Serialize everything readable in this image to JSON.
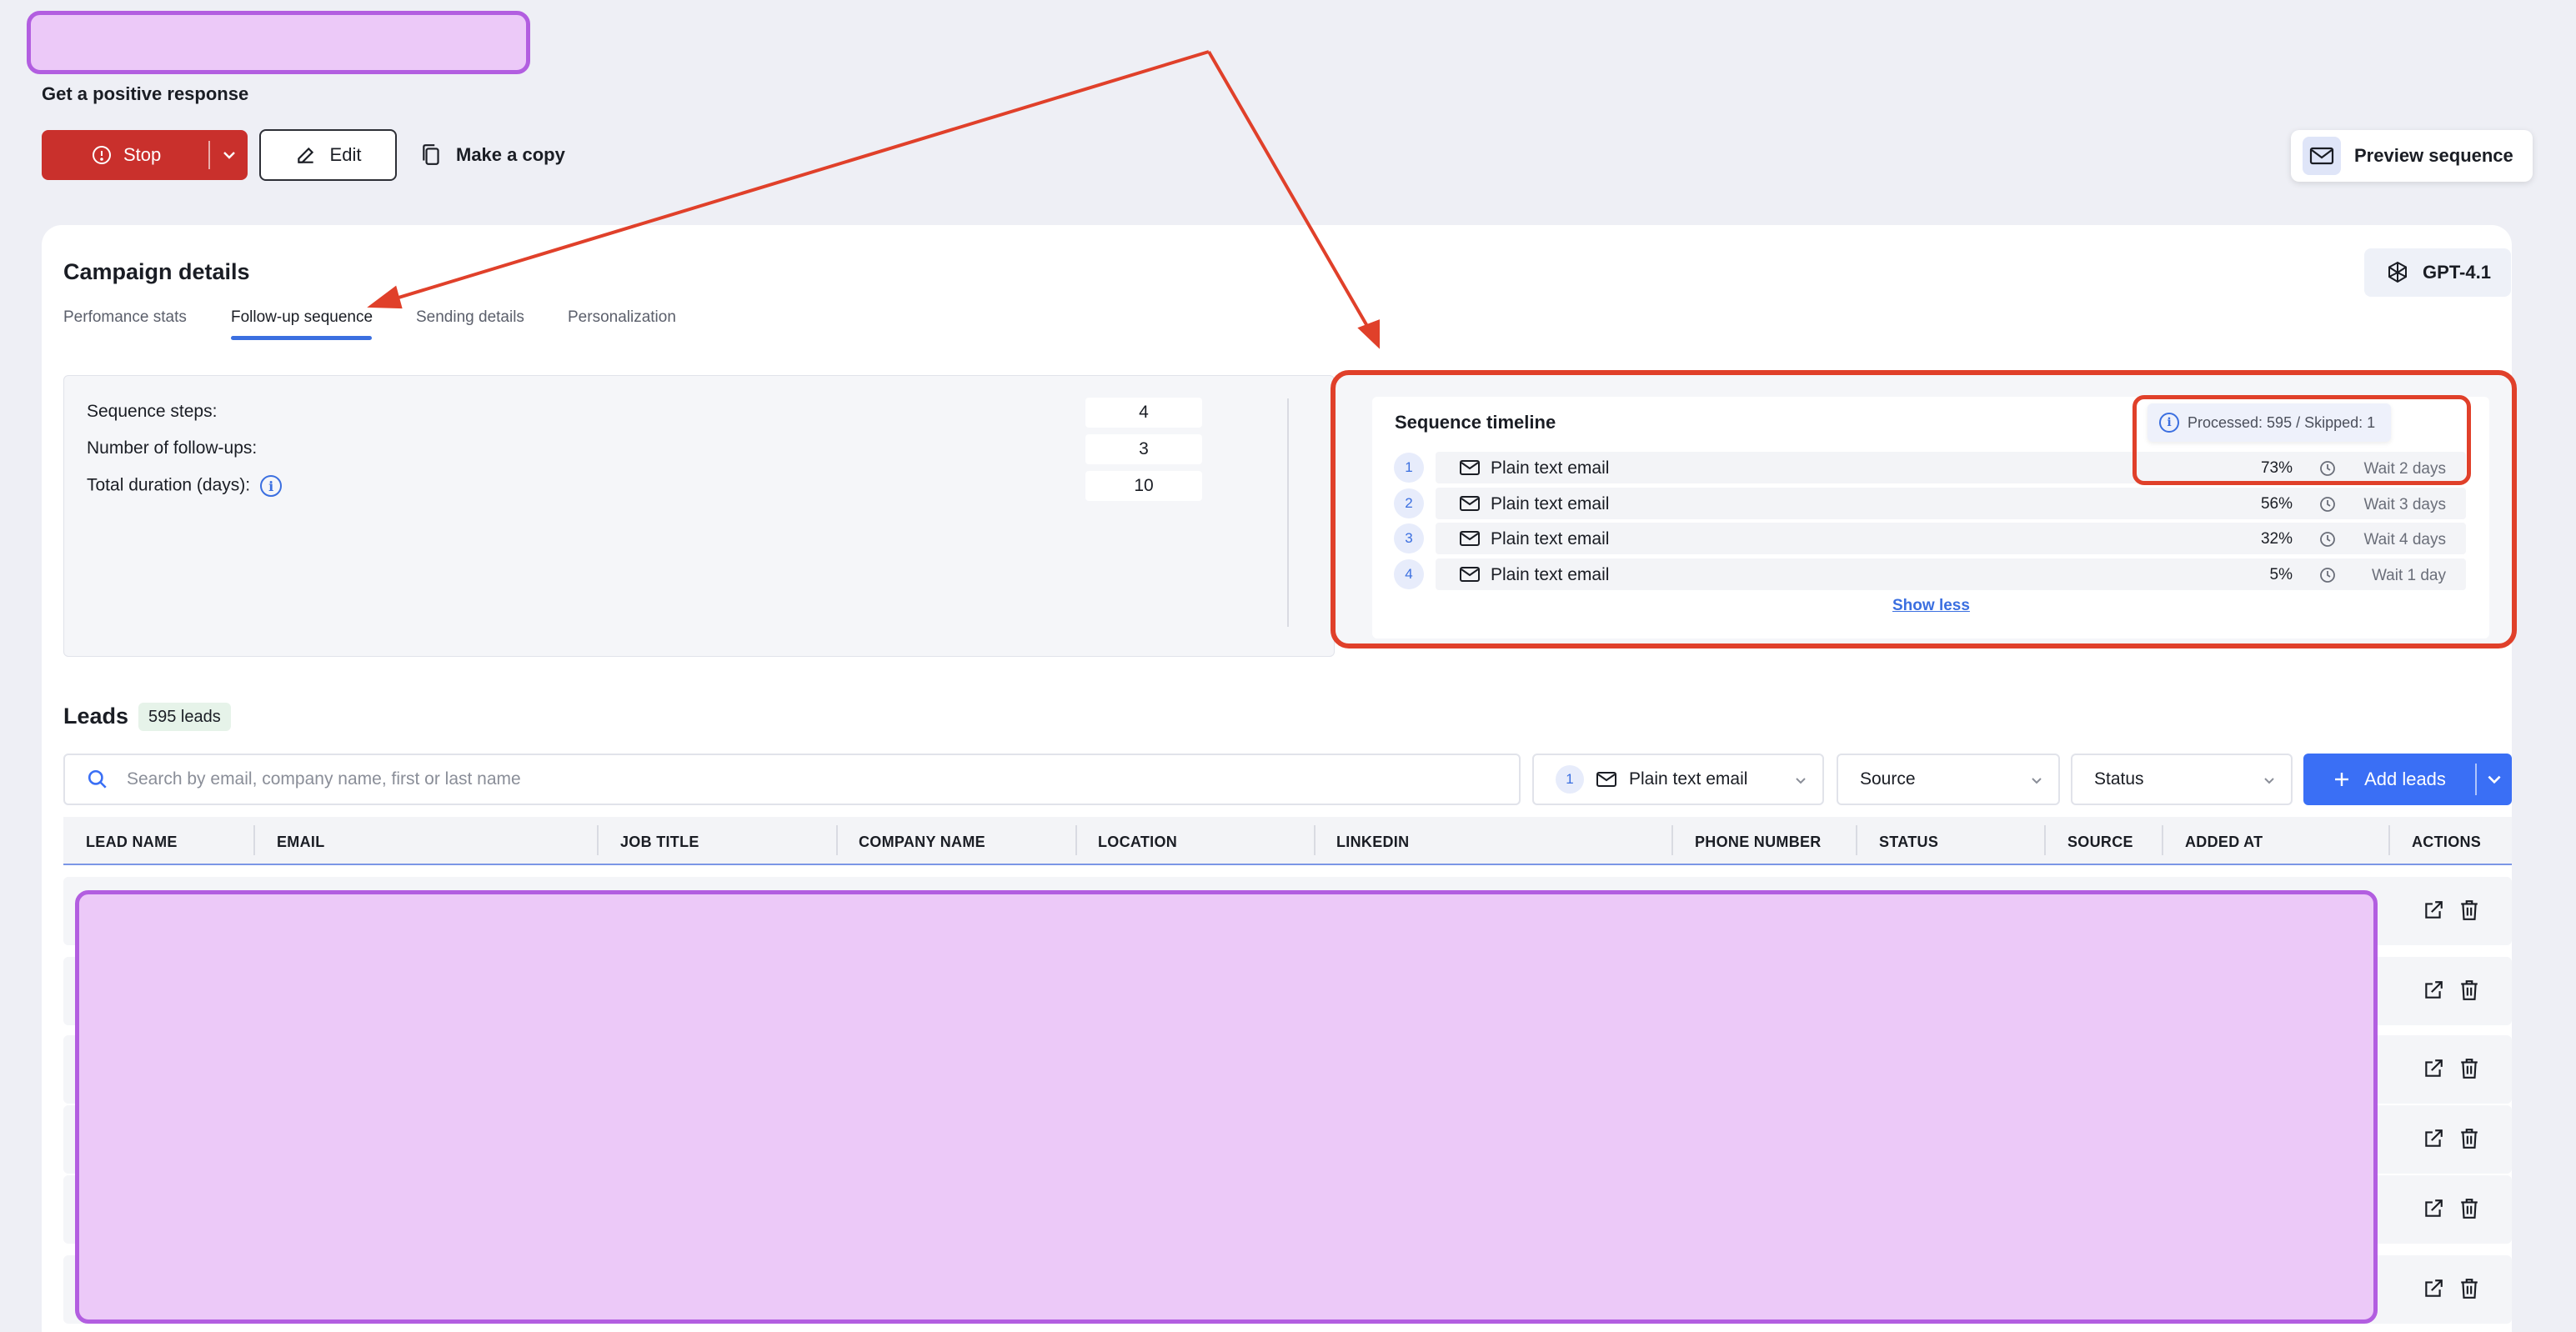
{
  "header": {
    "subtitle": "Get a positive response",
    "stop_label": "Stop",
    "edit_label": "Edit",
    "copy_label": "Make a copy",
    "preview_label": "Preview sequence"
  },
  "campaign": {
    "title": "Campaign details",
    "model": "GPT-4.1",
    "tabs": [
      {
        "label": "Perfomance stats",
        "active": false
      },
      {
        "label": "Follow-up sequence",
        "active": true
      },
      {
        "label": "Sending details",
        "active": false
      },
      {
        "label": "Personalization",
        "active": false
      }
    ],
    "stats": [
      {
        "label": "Sequence steps:",
        "value": "4"
      },
      {
        "label": "Number of follow-ups:",
        "value": "3"
      },
      {
        "label": "Total duration (days):",
        "value": "10"
      }
    ]
  },
  "timeline": {
    "title": "Sequence timeline",
    "tooltip": "Processed: 595 / Skipped: 1",
    "steps": [
      {
        "num": "1",
        "label": "Plain text email",
        "pct": "73%",
        "wait": "Wait 2 days"
      },
      {
        "num": "2",
        "label": "Plain text email",
        "pct": "56%",
        "wait": "Wait 3 days"
      },
      {
        "num": "3",
        "label": "Plain text email",
        "pct": "32%",
        "wait": "Wait 4 days"
      },
      {
        "num": "4",
        "label": "Plain text email",
        "pct": "5%",
        "wait": "Wait 1 day"
      }
    ],
    "show_less": "Show less"
  },
  "leads": {
    "title": "Leads",
    "count_badge": "595 leads",
    "search_placeholder": "Search by email, company name, first or last name",
    "step_filter_num": "1",
    "step_filter_label": "Plain text email",
    "source_filter": "Source",
    "status_filter": "Status",
    "add_label": "Add leads",
    "columns": [
      "LEAD NAME",
      "EMAIL",
      "JOB TITLE",
      "COMPANY NAME",
      "LOCATION",
      "LINKEDIN",
      "PHONE NUMBER",
      "STATUS",
      "SOURCE",
      "ADDED AT",
      "ACTIONS"
    ]
  },
  "colors": {
    "accent": "#3a6ff5",
    "stop": "#c9302c",
    "annotation": "#e0402a",
    "redaction": "#ecc9f8"
  }
}
